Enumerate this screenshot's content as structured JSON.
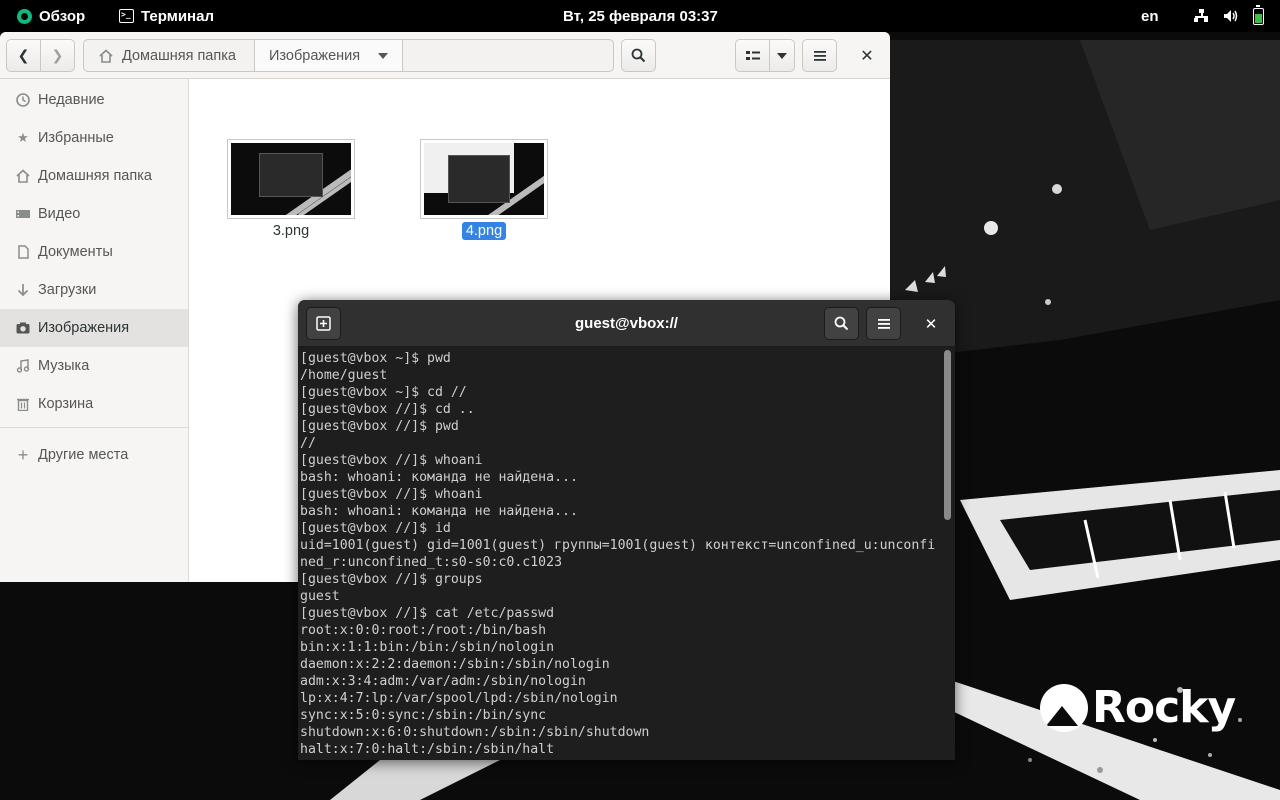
{
  "topbar": {
    "activities": "Обзор",
    "app_name": "Терминал",
    "clock": "Вт, 25 февраля  03:37",
    "input_language": "en"
  },
  "files_window": {
    "path": [
      "Домашняя папка",
      "Изображения"
    ],
    "sidebar": [
      {
        "label": "Недавние",
        "icon": "clock-icon"
      },
      {
        "label": "Избранные",
        "icon": "star-icon"
      },
      {
        "label": "Домашняя папка",
        "icon": "home-icon"
      },
      {
        "label": "Видео",
        "icon": "video-icon"
      },
      {
        "label": "Документы",
        "icon": "document-icon"
      },
      {
        "label": "Загрузки",
        "icon": "download-icon"
      },
      {
        "label": "Изображения",
        "icon": "camera-icon",
        "active": true
      },
      {
        "label": "Музыка",
        "icon": "music-icon"
      },
      {
        "label": "Корзина",
        "icon": "trash-icon"
      },
      {
        "label": "Другие места",
        "icon": "plus-icon"
      }
    ],
    "files": [
      {
        "name": "3.png",
        "selected": false
      },
      {
        "name": "4.png",
        "selected": true
      }
    ]
  },
  "terminal": {
    "title": "guest@vbox://",
    "lines": [
      "[guest@vbox ~]$ pwd",
      "/home/guest",
      "[guest@vbox ~]$ cd //",
      "[guest@vbox //]$ cd ..",
      "[guest@vbox //]$ pwd",
      "//",
      "[guest@vbox //]$ whoani",
      "bash: whoani: команда не найдена...",
      "[guest@vbox //]$ whoani",
      "bash: whoani: команда не найдена...",
      "[guest@vbox //]$ id",
      "uid=1001(guest) gid=1001(guest) группы=1001(guest) контекст=unconfined_u:unconfi",
      "ned_r:unconfined_t:s0-s0:c0.c1023",
      "[guest@vbox //]$ groups",
      "guest",
      "[guest@vbox //]$ cat /etc/passwd",
      "root:x:0:0:root:/root:/bin/bash",
      "bin:x:1:1:bin:/bin:/sbin/nologin",
      "daemon:x:2:2:daemon:/sbin:/sbin/nologin",
      "adm:x:3:4:adm:/var/adm:/sbin/nologin",
      "lp:x:4:7:lp:/var/spool/lpd:/sbin/nologin",
      "sync:x:5:0:sync:/sbin:/bin/sync",
      "shutdown:x:6:0:shutdown:/sbin:/sbin/shutdown",
      "halt:x:7:0:halt:/sbin:/sbin/halt"
    ]
  },
  "desktop": {
    "logo_text": "Rocky"
  },
  "colors": {
    "selection": "#3584e4",
    "terminal_bg": "#1e1e1e",
    "topbar_bg": "#000000"
  }
}
